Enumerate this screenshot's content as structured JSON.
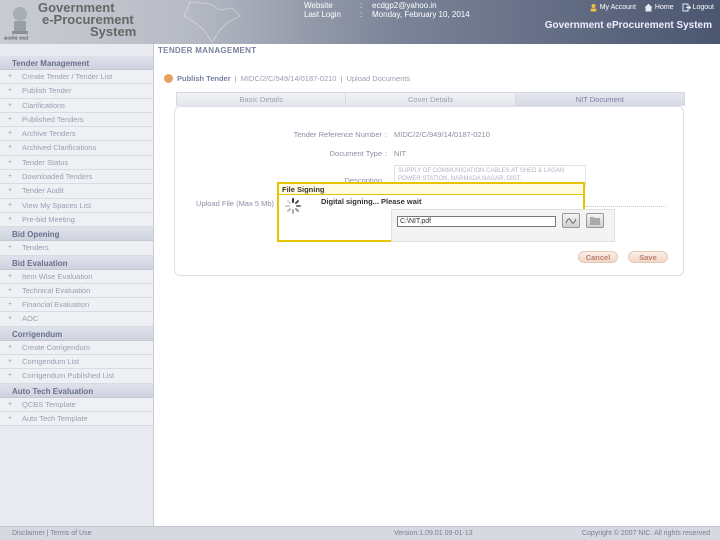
{
  "header": {
    "emblem_caption": "सत्यमेव जयते",
    "brand_line1": "Government",
    "brand_line2": "e-Procurement",
    "brand_line3": "System",
    "website_label": "Website",
    "website_value": "ecdgp2@yahoo.in",
    "last_login_label": "Last Login",
    "last_login_value": "Monday, February 10, 2014",
    "sep": ":",
    "link_myaccount": "My Account",
    "link_home": "Home",
    "link_logout": "Logout",
    "system_title": "Government eProcurement System"
  },
  "breadcrumb_title": "TENDER MANAGEMENT",
  "sidebar": {
    "sections": [
      {
        "title": "Tender Management",
        "items": [
          "Create Tender / Tender List",
          "Publish Tender",
          "Clarifications",
          "Published Tenders",
          "Archive Tenders",
          "Archived Clarifications",
          "Tender Status",
          "Downloaded Tenders",
          "Tender Audit",
          "View My Spaces List",
          "Pre-bid Meeting"
        ]
      },
      {
        "title": "Bid Opening",
        "items": [
          "Tenders"
        ]
      },
      {
        "title": "Bid Evaluation",
        "items": [
          "Item Wise Evaluation",
          "Technical Evaluation",
          "Financial Evaluation",
          "AOC"
        ]
      },
      {
        "title": "Corrigendum",
        "items": [
          "Create Corrigendum",
          "Corrigendum List",
          "Corrigendum Published List"
        ]
      },
      {
        "title": "Auto Tech Evaluation",
        "items": [
          "QCBS Template",
          "Auto Tech Template"
        ]
      }
    ]
  },
  "steps": {
    "step1": "Publish Tender",
    "sep": "|",
    "step2": "MIDC/2/C/949/14/0187-0210",
    "step3": "Upload Documents"
  },
  "tabs": [
    "Basic Details",
    "Cover Details",
    "NIT Document"
  ],
  "form": {
    "ref_label": "Tender Reference Number",
    "ref_value": "MIDC/2/C/949/14/0187-0210",
    "doctype_label": "Document Type",
    "doctype_value": "NIT",
    "desc_label": "Description",
    "desc_value": "SUPPLY OF COMMUNICATION CABLES AT SHED & LAGAN POWER STATION, NARMADA NAGAR, DIST.",
    "upload_label": "Upload File (Max 5 Mb)",
    "colon": ":"
  },
  "buttons": {
    "cancel": "Cancel",
    "save": "Save"
  },
  "dialog": {
    "title": "File Signing",
    "message": "Digital signing... Please wait",
    "file_value": "C:\\NIT.pdf"
  },
  "footer": {
    "left": "Disclaimer  |  Terms of Use",
    "center": "Version:1.09.01 09-01-13",
    "right": "Copyright © 2007 NIC. All rights reserved"
  },
  "colors": {
    "accent": "#e6c400",
    "header_dark": "#4b5670"
  }
}
